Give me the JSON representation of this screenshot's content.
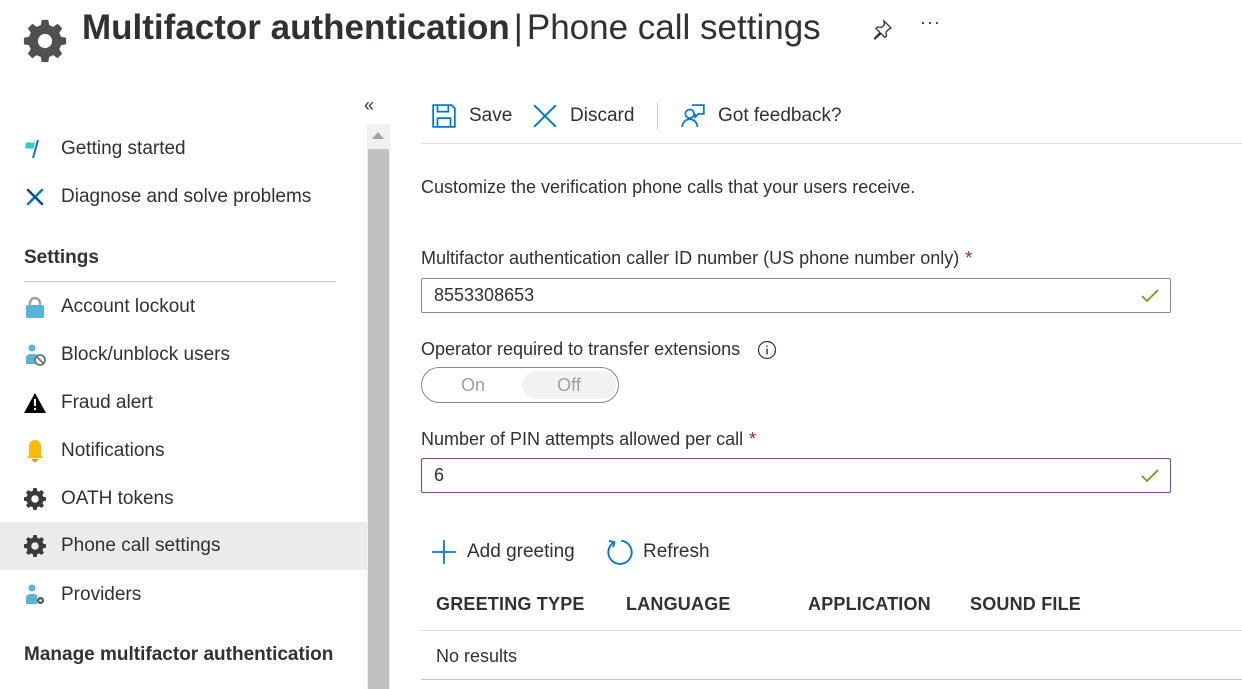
{
  "header": {
    "title_bold": "Multifactor authentication",
    "separator": "|",
    "title_sub": "Phone call settings",
    "more_label": "···",
    "icons": {
      "app": "gear-icon",
      "pin": "pin-icon",
      "more": "more-icon"
    }
  },
  "sidebar": {
    "collapse_label": "«",
    "items_top": [
      {
        "label": "Getting started",
        "icon": "flag-icon"
      },
      {
        "label": "Diagnose and solve problems",
        "icon": "wrench-icon"
      }
    ],
    "settings_title": "Settings",
    "settings_items": [
      {
        "label": "Account lockout",
        "icon": "lock-icon"
      },
      {
        "label": "Block/unblock users",
        "icon": "user-block-icon"
      },
      {
        "label": "Fraud alert",
        "icon": "warning-icon"
      },
      {
        "label": "Notifications",
        "icon": "bell-icon"
      },
      {
        "label": "OATH tokens",
        "icon": "gear-icon"
      },
      {
        "label": "Phone call settings",
        "icon": "gear-icon",
        "active": true
      },
      {
        "label": "Providers",
        "icon": "user-settings-icon"
      }
    ],
    "manage_title": "Manage multifactor authentication"
  },
  "toolbar": {
    "save_label": "Save",
    "discard_label": "Discard",
    "feedback_label": "Got feedback?"
  },
  "main": {
    "description": "Customize the verification phone calls that your users receive.",
    "caller_id": {
      "label": "Multifactor authentication caller ID number (US phone number only)",
      "required_mark": "*",
      "value": "8553308653",
      "valid": true
    },
    "operator": {
      "label": "Operator required to transfer extensions",
      "on_label": "On",
      "off_label": "Off",
      "selected": "Off"
    },
    "pin_attempts": {
      "label": "Number of PIN attempts allowed per call",
      "required_mark": "*",
      "value": "6",
      "valid": true
    },
    "actions": {
      "add_label": "Add greeting",
      "refresh_label": "Refresh"
    },
    "table": {
      "columns": [
        "GREETING TYPE",
        "LANGUAGE",
        "APPLICATION",
        "SOUND FILE"
      ],
      "rows": [],
      "empty_text": "No results"
    }
  },
  "colors": {
    "accent": "#0078d4",
    "required": "#a4262c",
    "valid": "#57a300",
    "focus_border": "#8a3c9e",
    "active_nav": "#edebe9"
  }
}
